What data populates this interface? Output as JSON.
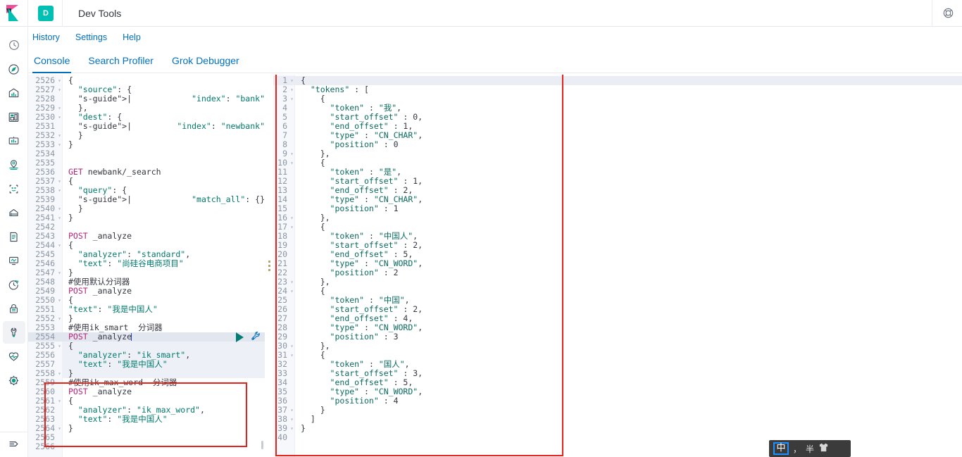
{
  "header": {
    "logo_name": "kibana-logo",
    "space_badge": "D",
    "app_title": "Dev Tools",
    "help_icon": "help-globe-icon"
  },
  "sidebar": {
    "items": [
      {
        "icon": "recently-viewed-clock-icon",
        "active": false
      },
      {
        "icon": "discover-compass-icon",
        "active": false
      },
      {
        "icon": "visualize-bar-chart-icon",
        "active": false
      },
      {
        "icon": "dashboard-layout-icon",
        "active": false
      },
      {
        "icon": "canvas-presentation-icon",
        "active": false
      },
      {
        "icon": "maps-location-icon",
        "active": false
      },
      {
        "icon": "machine-learning-icon",
        "active": false
      },
      {
        "icon": "infrastructure-server-icon",
        "active": false
      },
      {
        "icon": "logs-document-icon",
        "active": false
      },
      {
        "icon": "apm-monitor-icon",
        "active": false
      },
      {
        "icon": "uptime-clock-arrow-icon",
        "active": false
      },
      {
        "icon": "security-lock-icon",
        "active": false
      },
      {
        "icon": "dev-tools-wrench-icon",
        "active": true
      },
      {
        "icon": "monitoring-heartbeat-icon",
        "active": false
      },
      {
        "icon": "management-gear-icon",
        "active": false
      }
    ],
    "collapse_icon": "collapse-arrow-icon"
  },
  "nav": {
    "links": [
      {
        "label": "History"
      },
      {
        "label": "Settings"
      },
      {
        "label": "Help"
      }
    ]
  },
  "tabs": [
    {
      "label": "Console",
      "active": true
    },
    {
      "label": "Search Profiler",
      "active": false
    },
    {
      "label": "Grok Debugger",
      "active": false
    }
  ],
  "editor": {
    "first_line_number": 2526,
    "active_line_number": 2554,
    "run_icon": "play-triangle-icon",
    "wrench_icon": "wrench-icon",
    "splitter_icon": "drag-handle-dots-icon",
    "lines": [
      {
        "n": 2526,
        "fold": true,
        "text": "{"
      },
      {
        "n": 2527,
        "fold": true,
        "text": "  \"source\": {"
      },
      {
        "n": 2528,
        "fold": false,
        "text": "  |  \"index\": \"bank\""
      },
      {
        "n": 2529,
        "fold": true,
        "text": "  },"
      },
      {
        "n": 2530,
        "fold": true,
        "text": "  \"dest\": {"
      },
      {
        "n": 2531,
        "fold": false,
        "text": "  |  \"index\": \"newbank\""
      },
      {
        "n": 2532,
        "fold": true,
        "text": "  }"
      },
      {
        "n": 2533,
        "fold": true,
        "text": "}"
      },
      {
        "n": 2534,
        "fold": false,
        "text": ""
      },
      {
        "n": 2535,
        "fold": false,
        "text": ""
      },
      {
        "n": 2536,
        "fold": false,
        "text": "GET newbank/_search"
      },
      {
        "n": 2537,
        "fold": true,
        "text": "{"
      },
      {
        "n": 2538,
        "fold": true,
        "text": "  \"query\": {"
      },
      {
        "n": 2539,
        "fold": false,
        "text": "  |  \"match_all\": {}"
      },
      {
        "n": 2540,
        "fold": true,
        "text": "  }"
      },
      {
        "n": 2541,
        "fold": true,
        "text": "}"
      },
      {
        "n": 2542,
        "fold": false,
        "text": ""
      },
      {
        "n": 2543,
        "fold": false,
        "text": "POST _analyze"
      },
      {
        "n": 2544,
        "fold": true,
        "text": "{"
      },
      {
        "n": 2545,
        "fold": false,
        "text": "  \"analyzer\": \"standard\","
      },
      {
        "n": 2546,
        "fold": false,
        "text": "  \"text\": \"尚硅谷电商项目\""
      },
      {
        "n": 2547,
        "fold": true,
        "text": "}"
      },
      {
        "n": 2548,
        "fold": false,
        "text": "#使用默认分词器"
      },
      {
        "n": 2549,
        "fold": false,
        "text": "POST _analyze"
      },
      {
        "n": 2550,
        "fold": true,
        "text": "{"
      },
      {
        "n": 2551,
        "fold": false,
        "text": "\"text\": \"我是中国人\""
      },
      {
        "n": 2552,
        "fold": true,
        "text": "}"
      },
      {
        "n": 2553,
        "fold": false,
        "text": "#使用ik_smart  分词器"
      },
      {
        "n": 2554,
        "fold": false,
        "text": "POST _analyze"
      },
      {
        "n": 2555,
        "fold": true,
        "text": "{"
      },
      {
        "n": 2556,
        "fold": false,
        "text": "  \"analyzer\": \"ik_smart\","
      },
      {
        "n": 2557,
        "fold": false,
        "text": "  \"text\": \"我是中国人\""
      },
      {
        "n": 2558,
        "fold": true,
        "text": "}"
      },
      {
        "n": 2559,
        "fold": false,
        "text": "#使用ik_max_word  分词器"
      },
      {
        "n": 2560,
        "fold": false,
        "text": "POST _analyze"
      },
      {
        "n": 2561,
        "fold": true,
        "text": "{"
      },
      {
        "n": 2562,
        "fold": false,
        "text": "  \"analyzer\": \"ik_max_word\","
      },
      {
        "n": 2563,
        "fold": false,
        "text": "  \"text\": \"我是中国人\""
      },
      {
        "n": 2564,
        "fold": true,
        "text": "}"
      },
      {
        "n": 2565,
        "fold": false,
        "text": ""
      },
      {
        "n": 2566,
        "fold": false,
        "text": ""
      }
    ]
  },
  "response": {
    "lines": [
      {
        "n": 1,
        "fold": true,
        "text": "{"
      },
      {
        "n": 2,
        "fold": true,
        "text": "  \"tokens\" : ["
      },
      {
        "n": 3,
        "fold": true,
        "text": "    {"
      },
      {
        "n": 4,
        "fold": false,
        "text": "      \"token\" : \"我\","
      },
      {
        "n": 5,
        "fold": false,
        "text": "      \"start_offset\" : 0,"
      },
      {
        "n": 6,
        "fold": false,
        "text": "      \"end_offset\" : 1,"
      },
      {
        "n": 7,
        "fold": false,
        "text": "      \"type\" : \"CN_CHAR\","
      },
      {
        "n": 8,
        "fold": false,
        "text": "      \"position\" : 0"
      },
      {
        "n": 9,
        "fold": true,
        "text": "    },"
      },
      {
        "n": 10,
        "fold": true,
        "text": "    {"
      },
      {
        "n": 11,
        "fold": false,
        "text": "      \"token\" : \"是\","
      },
      {
        "n": 12,
        "fold": false,
        "text": "      \"start_offset\" : 1,"
      },
      {
        "n": 13,
        "fold": false,
        "text": "      \"end_offset\" : 2,"
      },
      {
        "n": 14,
        "fold": false,
        "text": "      \"type\" : \"CN_CHAR\","
      },
      {
        "n": 15,
        "fold": false,
        "text": "      \"position\" : 1"
      },
      {
        "n": 16,
        "fold": true,
        "text": "    },"
      },
      {
        "n": 17,
        "fold": true,
        "text": "    {"
      },
      {
        "n": 18,
        "fold": false,
        "text": "      \"token\" : \"中国人\","
      },
      {
        "n": 19,
        "fold": false,
        "text": "      \"start_offset\" : 2,"
      },
      {
        "n": 20,
        "fold": false,
        "text": "      \"end_offset\" : 5,"
      },
      {
        "n": 21,
        "fold": false,
        "text": "      \"type\" : \"CN_WORD\","
      },
      {
        "n": 22,
        "fold": false,
        "text": "      \"position\" : 2"
      },
      {
        "n": 23,
        "fold": true,
        "text": "    },"
      },
      {
        "n": 24,
        "fold": true,
        "text": "    {"
      },
      {
        "n": 25,
        "fold": false,
        "text": "      \"token\" : \"中国\","
      },
      {
        "n": 26,
        "fold": false,
        "text": "      \"start_offset\" : 2,"
      },
      {
        "n": 27,
        "fold": false,
        "text": "      \"end_offset\" : 4,"
      },
      {
        "n": 28,
        "fold": false,
        "text": "      \"type\" : \"CN_WORD\","
      },
      {
        "n": 29,
        "fold": false,
        "text": "      \"position\" : 3"
      },
      {
        "n": 30,
        "fold": true,
        "text": "    },"
      },
      {
        "n": 31,
        "fold": true,
        "text": "    {"
      },
      {
        "n": 32,
        "fold": false,
        "text": "      \"token\" : \"国人\","
      },
      {
        "n": 33,
        "fold": false,
        "text": "      \"start_offset\" : 3,"
      },
      {
        "n": 34,
        "fold": false,
        "text": "      \"end_offset\" : 5,"
      },
      {
        "n": 35,
        "fold": false,
        "text": "      \"type\" : \"CN_WORD\","
      },
      {
        "n": 36,
        "fold": false,
        "text": "      \"position\" : 4"
      },
      {
        "n": 37,
        "fold": true,
        "text": "    }"
      },
      {
        "n": 38,
        "fold": true,
        "text": "  ]"
      },
      {
        "n": 39,
        "fold": true,
        "text": "}"
      },
      {
        "n": 40,
        "fold": false,
        "text": ""
      }
    ]
  },
  "annotations": {
    "boxes": [
      {
        "name": "response-highlight-box"
      },
      {
        "name": "ik-max-word-request-highlight-box"
      }
    ],
    "color": "#e7221a"
  },
  "ime": {
    "mode_label": "中",
    "punct_label": "，",
    "width_label": "半",
    "skin_icon": "ime-skin-shirt-icon"
  }
}
